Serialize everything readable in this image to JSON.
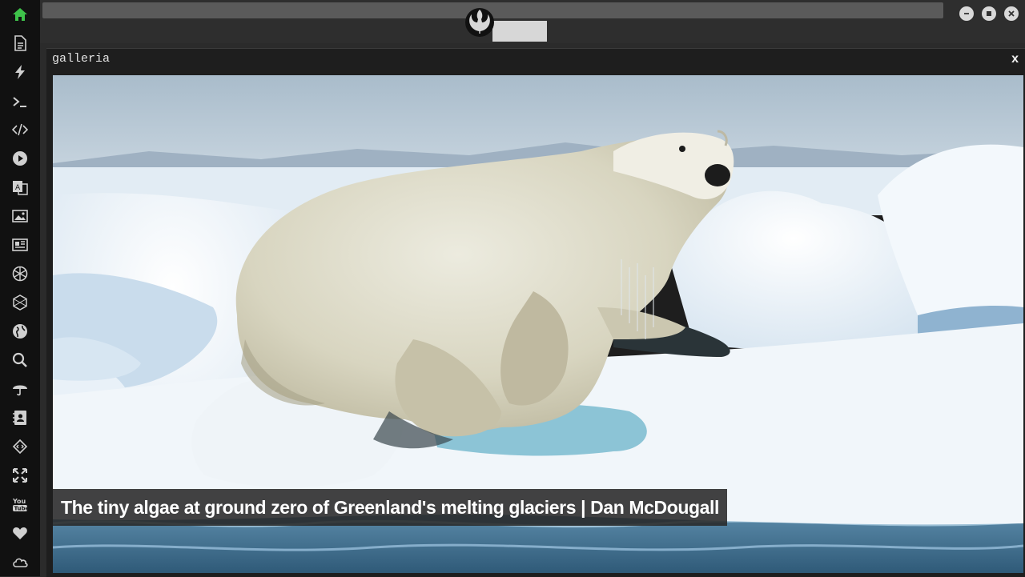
{
  "window": {
    "title": "galleria",
    "close_label": "x"
  },
  "gallery": {
    "caption": "The tiny algae at ground zero of Greenland's melting glaciers | Dan McDougall",
    "image": "polar bear leaping out of water onto sea ice"
  },
  "sidebar": {
    "icons": [
      "home-icon",
      "document-icon",
      "lightning-icon",
      "terminal-icon",
      "code-icon",
      "play-icon",
      "translate-icon",
      "image-icon",
      "news-icon",
      "aperture-icon",
      "hexagon-icon",
      "globe-icon",
      "search-icon",
      "umbrella-icon",
      "contact-icon",
      "embed-icon",
      "expand-icon",
      "youtube-icon",
      "heart-icon",
      "cloud-icon"
    ]
  },
  "colors": {
    "accent_home": "#3ec24a",
    "sidebar_bg": "#111111",
    "icon": "#d0d0d0"
  }
}
